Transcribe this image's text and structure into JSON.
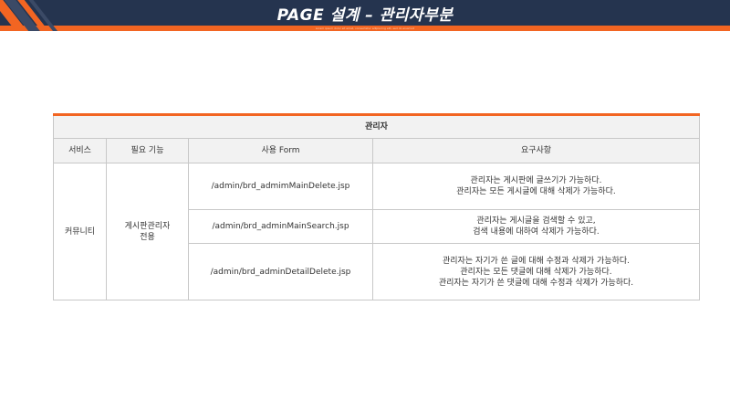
{
  "header": {
    "title": "PAGE 설계 – 관리자부분",
    "subtitle": "Lorem ipsum dolor sit amet, consectetur adipiscing elit, sed do eiusmod"
  },
  "colors": {
    "header_bg": "#25344f",
    "accent": "#f26522",
    "table_header_bg": "#f2f2f2",
    "border": "#c8c8c8"
  },
  "table": {
    "title": "관리자",
    "columns": [
      "서비스",
      "필요 기능",
      "사용 Form",
      "요구사항"
    ],
    "service": "커뮤니티",
    "feature_lines": [
      "게시판관리자",
      "전용"
    ],
    "rows": [
      {
        "form": "/admin/brd_admimMainDelete.jsp",
        "requirements": [
          "관리자는 게시판에 글쓰기가 가능하다.",
          "관리자는 모든 게시글에 대해 삭제가 가능하다."
        ]
      },
      {
        "form": "/admin/brd_adminMainSearch.jsp",
        "requirements": [
          "관리자는 게시글을 검색할 수 있고,",
          "검색 내용에 대하여 삭제가 가능하다."
        ]
      },
      {
        "form": "/admin/brd_adminDetailDelete.jsp",
        "requirements": [
          "관리자는 자기가 쓴 글에 대해 수정과 삭제가 가능하다.",
          "관리자는 모든 댓글에 대해 삭제가 가능하다.",
          "관리자는 자기가 쓴 댓글에 대해 수정과 삭제가 가능하다."
        ]
      }
    ]
  }
}
